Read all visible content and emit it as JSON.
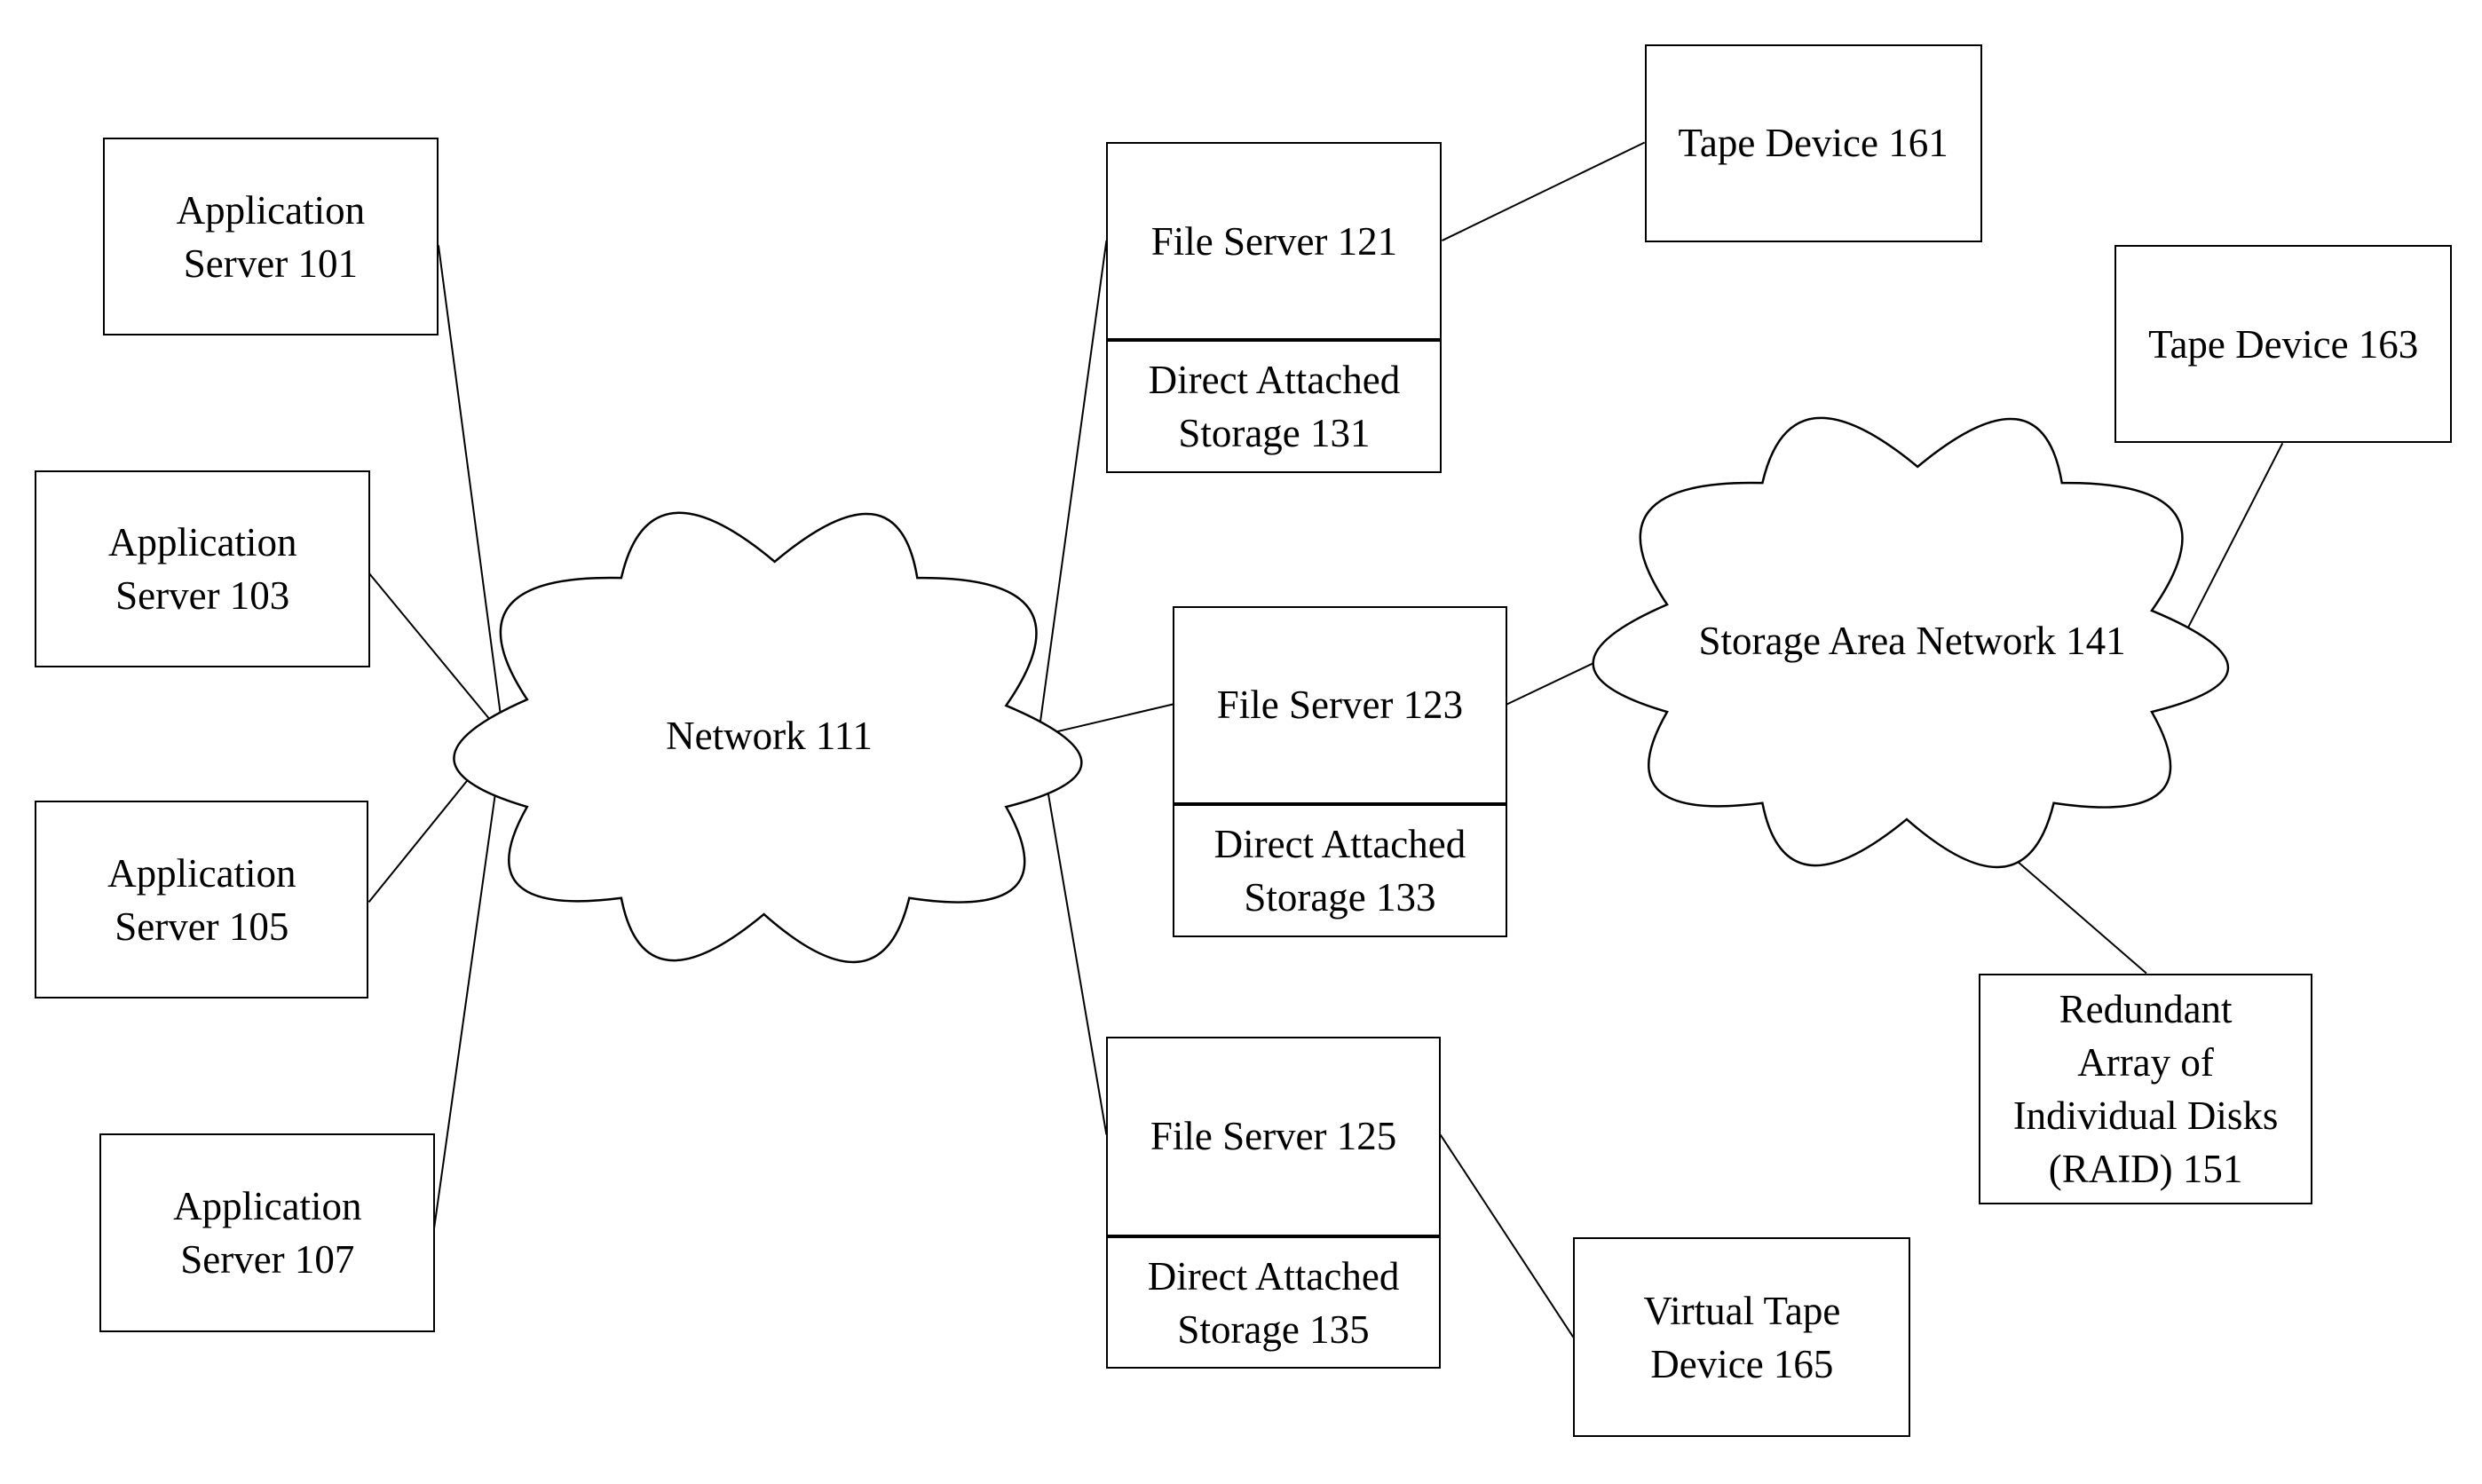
{
  "diagram": {
    "nodes": [
      {
        "id": "app101",
        "kind": "box",
        "label": "Application\nServer 101"
      },
      {
        "id": "app103",
        "kind": "box",
        "label": "Application\nServer 103"
      },
      {
        "id": "app105",
        "kind": "box",
        "label": "Application\nServer 105"
      },
      {
        "id": "app107",
        "kind": "box",
        "label": "Application\nServer 107"
      },
      {
        "id": "net111",
        "kind": "cloud",
        "label": "Network 111"
      },
      {
        "id": "fs121",
        "kind": "box",
        "label": "File Server 121"
      },
      {
        "id": "das131",
        "kind": "box",
        "label": "Direct Attached\nStorage 131"
      },
      {
        "id": "fs123",
        "kind": "box",
        "label": "File Server 123"
      },
      {
        "id": "das133",
        "kind": "box",
        "label": "Direct Attached\nStorage 133"
      },
      {
        "id": "fs125",
        "kind": "box",
        "label": "File Server 125"
      },
      {
        "id": "das135",
        "kind": "box",
        "label": "Direct Attached\nStorage 135"
      },
      {
        "id": "san141",
        "kind": "cloud",
        "label": "Storage Area Network 141"
      },
      {
        "id": "tape161",
        "kind": "box",
        "label": "Tape Device 161"
      },
      {
        "id": "tape163",
        "kind": "box",
        "label": "Tape Device 163"
      },
      {
        "id": "vtape165",
        "kind": "box",
        "label": "Virtual Tape\nDevice 165"
      },
      {
        "id": "raid151",
        "kind": "box",
        "label": "Redundant\nArray of\nIndividual Disks\n(RAID) 151"
      }
    ],
    "edges": [
      [
        "app101",
        "net111"
      ],
      [
        "app103",
        "net111"
      ],
      [
        "app105",
        "net111"
      ],
      [
        "app107",
        "net111"
      ],
      [
        "net111",
        "fs121"
      ],
      [
        "net111",
        "fs123"
      ],
      [
        "net111",
        "fs125"
      ],
      [
        "fs121",
        "tape161"
      ],
      [
        "fs123",
        "san141"
      ],
      [
        "san141",
        "tape163"
      ],
      [
        "san141",
        "raid151"
      ],
      [
        "fs125",
        "vtape165"
      ]
    ]
  }
}
